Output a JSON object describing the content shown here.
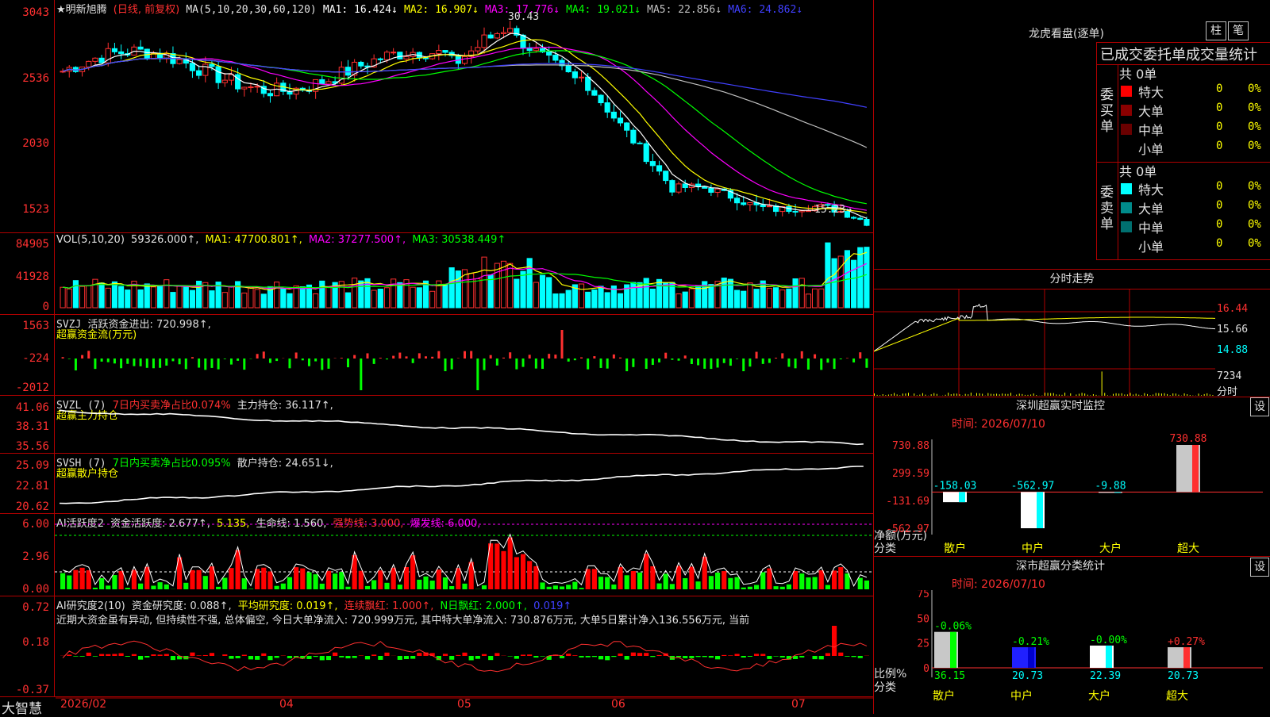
{
  "main_header": {
    "name": "★明新旭腾",
    "mode": "(日线, 前复权)",
    "ma": "MA(5,10,20,30,60,120)",
    "ma1": "MA1: 16.424↓",
    "ma2": "MA2: 16.907↓",
    "ma3": "MA3: 17.776↓",
    "ma4": "MA4: 19.021↓",
    "ma5": "MA5: 22.856↓",
    "ma6": "MA6: 24.862↓",
    "high_label": "30.43",
    "low_label": "15.23→"
  },
  "main_ticks": [
    "3043",
    "2536",
    "2030",
    "1523"
  ],
  "vol_header": {
    "name": "VOL(5,10,20)",
    "v": "59326.000↑,",
    "ma1": "MA1: 47700.801↑,",
    "ma2": "MA2: 37277.500↑,",
    "ma3": "MA3: 30538.449↑"
  },
  "vol_ticks": [
    "84905",
    "41928",
    "0"
  ],
  "svzj": {
    "name": "SVZJ",
    "label": "活跃资金进出: 720.998↑,",
    "sub": "超赢资金流(万元)",
    "ticks": [
      "1563",
      "-224",
      "-2012"
    ]
  },
  "svzl": {
    "name": "SVZL (7)",
    "label": "7日内买卖净占比0.074%",
    "hold": "主力持仓: 36.117↑,",
    "sub": "超赢主力持仓",
    "ticks": [
      "41.06",
      "38.31",
      "35.56"
    ]
  },
  "svsh": {
    "name": "SVSH (7)",
    "label": "7日内买卖净占比0.095%",
    "hold": "散户持仓: 24.651↓,",
    "sub": "超赢散户持仓",
    "ticks": [
      "25.09",
      "22.81",
      "20.62"
    ]
  },
  "ai1": {
    "name": "AI活跃度2",
    "a": "资金活跃度: 2.677↑,",
    "b": "5.135,",
    "c": "生命线: 1.560,",
    "d": "强势线: 3.000,",
    "e": "爆发线: 6.000,",
    "ticks": [
      "6.00",
      "2.96",
      "0.00"
    ]
  },
  "ai2": {
    "name": "AI研究度2(10)",
    "a": "资金研究度: 0.088↑,",
    "b": "平均研究度: 0.019↑,",
    "c": "连续飘红: 1.000↑,",
    "d": "N日飘红: 2.000↑,",
    "e": "0.019↑",
    "text": "近期大资金虽有异动, 但持续性不强, 总体偏空, 今日大单净流入: 720.999万元, 其中特大单净流入: 730.876万元, 大单5日累计净入136.556万元, 当前",
    "ticks": [
      "0.72",
      "0.18",
      "-0.37"
    ]
  },
  "xaxis": {
    "brand": "大智慧",
    "labels": [
      "2026/02",
      "04",
      "05",
      "06",
      "07"
    ]
  },
  "right_top": {
    "title": "龙虎看盘(逐单)",
    "btn1": "柱",
    "btn2": "笔",
    "tabs": "已成交委托单成交量统计",
    "buy_label": "委买单",
    "sell_label": "委卖单",
    "buy_total": "共 0单",
    "sell_total": "共 0单",
    "rows_buy": [
      {
        "name": "特大",
        "n": "0",
        "pct": "0%",
        "color": "#ff0000"
      },
      {
        "name": "大单",
        "n": "0",
        "pct": "0%",
        "color": "#8b0000"
      },
      {
        "name": "中单",
        "n": "0",
        "pct": "0%",
        "color": "#6a0000"
      },
      {
        "name": "小单",
        "n": "0",
        "pct": "0%",
        "color": "#000000"
      }
    ],
    "rows_sell": [
      {
        "name": "特大",
        "n": "0",
        "pct": "0%",
        "color": "#00ffff"
      },
      {
        "name": "大单",
        "n": "0",
        "pct": "0%",
        "color": "#008b8b"
      },
      {
        "name": "中单",
        "n": "0",
        "pct": "0%",
        "color": "#007070"
      },
      {
        "name": "小单",
        "n": "0",
        "pct": "0%",
        "color": "#000000"
      }
    ]
  },
  "intraday": {
    "title": "分时走势",
    "ticks": [
      "16.44",
      "15.66",
      "14.88",
      "7234",
      "分时"
    ]
  },
  "sz_monitor": {
    "title": "深圳超赢实时监控",
    "btn": "设",
    "time": "时间: 2026/07/10",
    "ticks": [
      "730.88",
      "299.59",
      "-131.69",
      "-562.97"
    ],
    "unit": "净额(万元)",
    "cat_label": "分类",
    "cats": [
      "散户",
      "中户",
      "大户",
      "超大"
    ],
    "values": [
      -158.03,
      -562.97,
      -9.88,
      730.88
    ],
    "value_labels": [
      "-158.03",
      "-562.97",
      "-9.88",
      "730.88"
    ]
  },
  "sz_class": {
    "title": "深市超赢分类统计",
    "btn": "设",
    "time": "时间: 2026/07/10",
    "ticks": [
      "75",
      "50",
      "25",
      "0"
    ],
    "unit": "比例%",
    "cat_label": "分类",
    "cats": [
      "散户",
      "中户",
      "大户",
      "超大"
    ],
    "values": [
      36.15,
      20.73,
      22.39,
      20.73
    ],
    "value_labels": [
      "36.15",
      "20.73",
      "22.39",
      "20.73"
    ],
    "changes": [
      "-0.06%",
      "-0.21%",
      "-0.00%",
      "+0.27%"
    ]
  },
  "chart_data": [
    {
      "type": "bar",
      "title": "深圳超赢实时监控",
      "categories": [
        "散户",
        "中户",
        "大户",
        "超大"
      ],
      "values": [
        -158.03,
        -562.97,
        -9.88,
        730.88
      ],
      "ylabel": "净额(万元)",
      "ylim": [
        -562.97,
        730.88
      ]
    },
    {
      "type": "bar",
      "title": "深市超赢分类统计",
      "categories": [
        "散户",
        "中户",
        "大户",
        "超大"
      ],
      "values": [
        36.15,
        20.73,
        22.39,
        20.73
      ],
      "ylabel": "比例%",
      "ylim": [
        0,
        75
      ]
    }
  ]
}
